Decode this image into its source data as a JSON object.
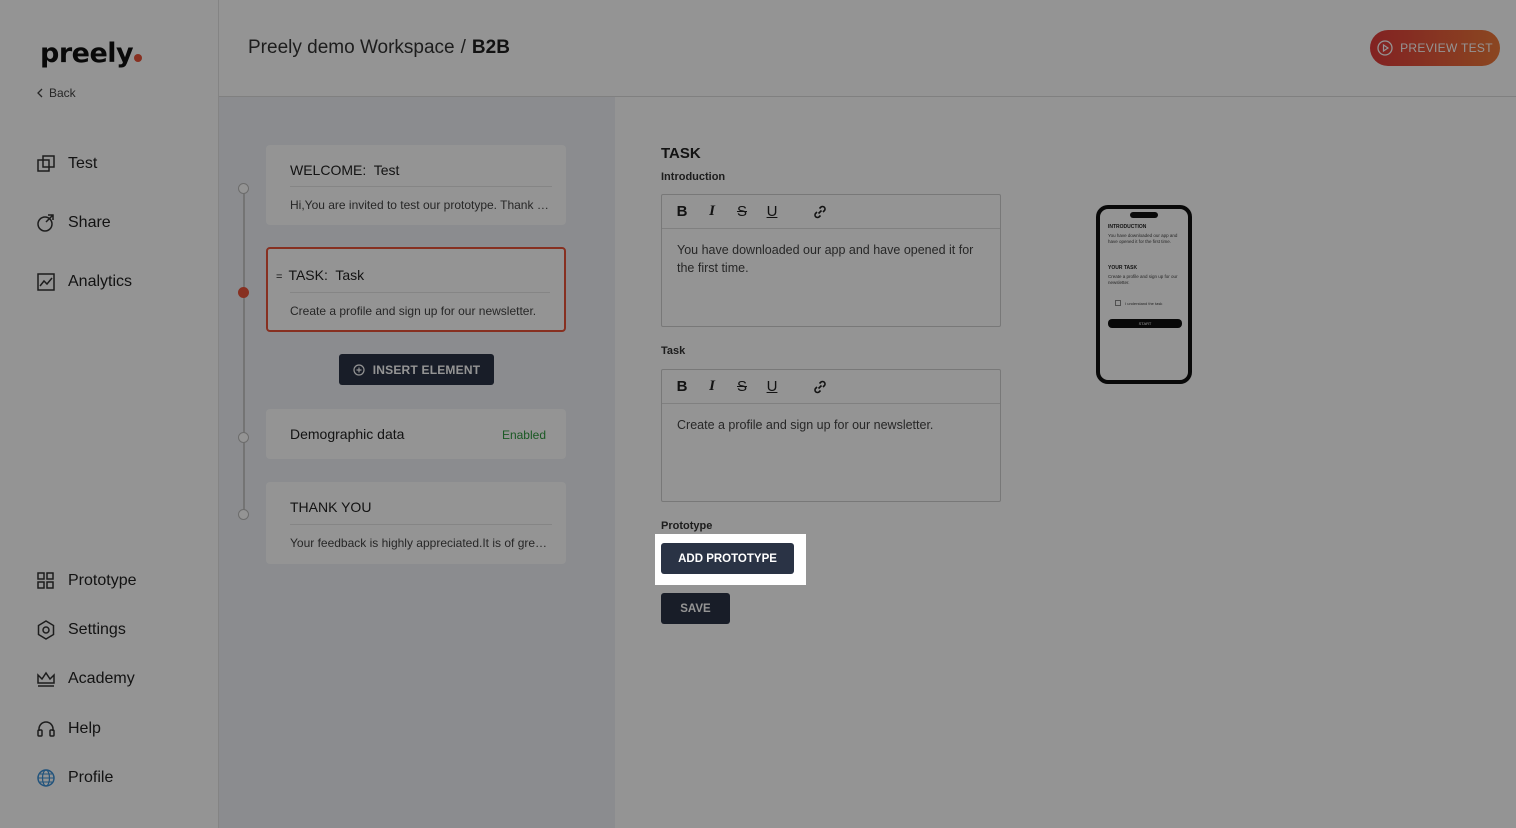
{
  "sidebar": {
    "logo": "preely",
    "back": "Back",
    "nav_top": [
      {
        "label": "Test",
        "icon": "test-icon"
      },
      {
        "label": "Share",
        "icon": "share-icon"
      },
      {
        "label": "Analytics",
        "icon": "analytics-icon"
      }
    ],
    "nav_bottom": [
      {
        "label": "Prototype",
        "icon": "grid-icon"
      },
      {
        "label": "Settings",
        "icon": "gear-icon"
      },
      {
        "label": "Academy",
        "icon": "crown-icon"
      },
      {
        "label": "Help",
        "icon": "headset-icon"
      },
      {
        "label": "Profile",
        "icon": "globe-icon"
      }
    ]
  },
  "header": {
    "workspace": "Preely demo Workspace",
    "separator": "/",
    "project": "B2B",
    "preview_label": "PREVIEW TEST"
  },
  "flow": {
    "cards": [
      {
        "prefix": "WELCOME:",
        "title": "Test",
        "body": "Hi,You are invited to test our prototype. Thank you for participating"
      },
      {
        "handle": "=",
        "prefix": "TASK:",
        "title": "Task",
        "body": "Create a profile and sign up for our newsletter."
      },
      {
        "title": "Demographic data",
        "status": "Enabled"
      },
      {
        "title": "THANK YOU",
        "body": "Your feedback is highly appreciated.It is of great value to us"
      }
    ],
    "insert_label": "INSERT ELEMENT"
  },
  "editor": {
    "section_title": "TASK",
    "intro_label": "Introduction",
    "intro_text": "You have downloaded our app and have opened it for the first time.",
    "task_label": "Task",
    "task_text": "Create a profile and sign up for our newsletter.",
    "toolbar": {
      "bold": "B",
      "italic": "I",
      "strike": "S",
      "underline": "U"
    },
    "prototype_label": "Prototype",
    "add_prototype": "ADD PROTOTYPE",
    "save": "SAVE"
  },
  "phone_preview": {
    "intro_heading": "INTRODUCTION",
    "intro_text": "You have downloaded our app and have opened it for the first time.",
    "task_heading": "YOUR TASK",
    "task_text": "Create a profile and sign up for our newsletter.",
    "checkbox_label": "I understand the task",
    "start": "START"
  },
  "colors": {
    "accent": "#e8533a",
    "dark_button": "#2a3345",
    "enabled": "#2e9a3e"
  }
}
